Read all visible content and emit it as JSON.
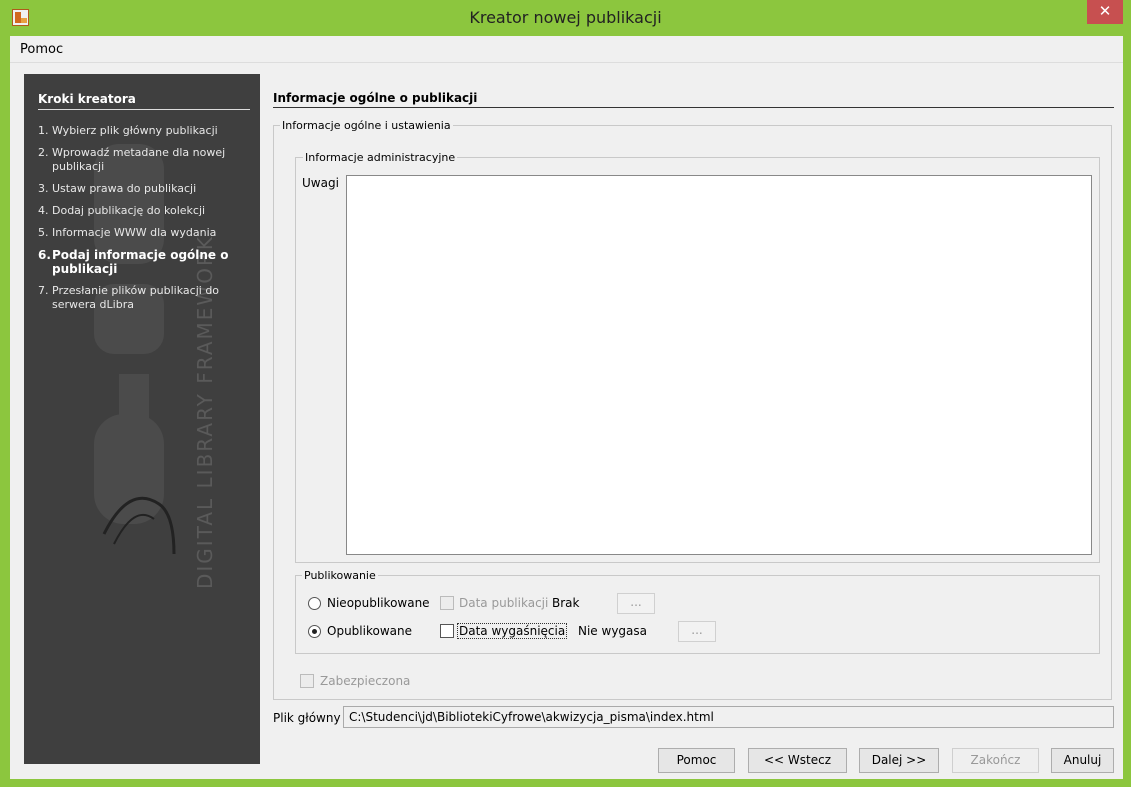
{
  "window": {
    "title": "Kreator nowej publikacji",
    "close_label": "✕"
  },
  "menu": {
    "items": [
      {
        "label": "Pomoc"
      }
    ]
  },
  "steps": {
    "title": "Kroki kreatora",
    "items": [
      {
        "num": "1.",
        "label": "Wybierz plik główny publikacji",
        "active": false
      },
      {
        "num": "2.",
        "label": "Wprowadź metadane dla nowej publikacji",
        "active": false
      },
      {
        "num": "3.",
        "label": "Ustaw prawa do publikacji",
        "active": false
      },
      {
        "num": "4.",
        "label": "Dodaj publikację do kolekcji",
        "active": false
      },
      {
        "num": "5.",
        "label": "Informacje WWW dla wydania",
        "active": false
      },
      {
        "num": "6.",
        "label": "Podaj informacje ogólne o publikacji",
        "active": true
      },
      {
        "num": "7.",
        "label": "Przesłanie plików publikacji do serwera dLibra",
        "active": false
      }
    ],
    "watermark_text": "DIGITAL LIBRARY FRAMEWORK"
  },
  "main": {
    "title": "Informacje ogólne o publikacji",
    "general_group_label": "Informacje ogólne i ustawienia",
    "admin_group_label": "Informacje administracyjne",
    "uwagi_label": "Uwagi",
    "uwagi_value": "",
    "publishing": {
      "group_label": "Publikowanie",
      "unpublished_label": "Nieopublikowane",
      "publication_date_label": "Data publikacji",
      "publication_date_value": "Brak",
      "published_label": "Opublikowane",
      "expiry_date_label": "Data wygaśnięcia",
      "expiry_date_value": "Nie wygasa",
      "dots_label": "...",
      "selected": "published"
    },
    "secured_label": "Zabezpieczona",
    "main_file_label": "Plik główny",
    "main_file_value": "C:\\Studenci\\jd\\BibliotekiCyfrowe\\akwizycja_pisma\\index.html"
  },
  "buttons": {
    "help": "Pomoc",
    "back": "<< Wstecz",
    "next": "Dalej >>",
    "finish": "Zakończ",
    "cancel": "Anuluj"
  },
  "colors": {
    "titlebar": "#8cc63e",
    "sidebar": "#3f3f3f",
    "close": "#c75050"
  }
}
